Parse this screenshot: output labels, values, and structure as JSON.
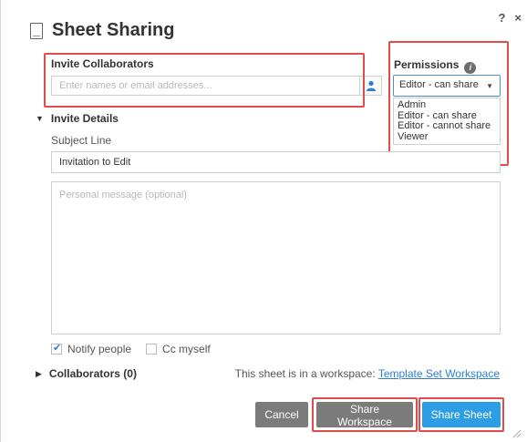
{
  "dialog": {
    "title": "Sheet Sharing",
    "help_label": "?",
    "close_label": "×"
  },
  "invite": {
    "label": "Invite Collaborators",
    "placeholder": "Enter names or email addresses..."
  },
  "permissions": {
    "label": "Permissions",
    "info_glyph": "i",
    "selected": "Editor - can share",
    "options": [
      "Admin",
      "Editor - can share",
      "Editor - cannot share",
      "Viewer"
    ]
  },
  "details": {
    "toggle_label": "Invite Details",
    "subject_label": "Subject Line",
    "subject_value": "Invitation to Edit",
    "message_placeholder": "Personal message (optional)"
  },
  "options": {
    "notify_label": "Notify people",
    "notify_checked": true,
    "cc_label": "Cc myself",
    "cc_checked": false
  },
  "collaborators": {
    "toggle_label": "Collaborators (0)",
    "workspace_note": "This sheet is in a workspace:",
    "workspace_link": "Template Set Workspace"
  },
  "buttons": {
    "cancel": "Cancel",
    "share_workspace": "Share Workspace",
    "share_sheet": "Share Sheet"
  },
  "colors": {
    "primary_button": "#2d9de6",
    "secondary_button": "#7b7b7b",
    "highlight_box": "#e04b4b",
    "link": "#2f7fd1"
  }
}
